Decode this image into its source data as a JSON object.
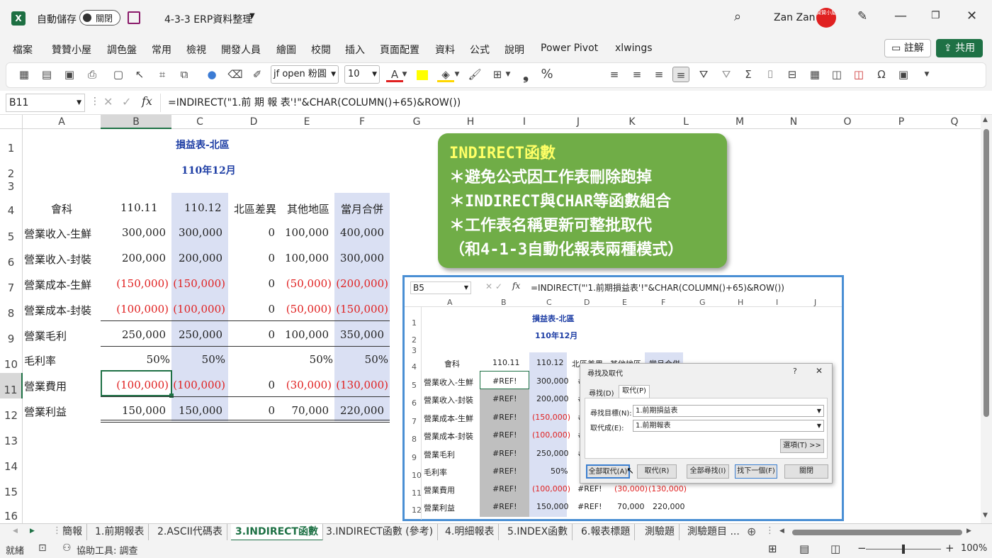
{
  "titlebar": {
    "autosave_label": "自動儲存",
    "autosave_state": "關閉",
    "file_name": "4-3-3 ERP資料整理",
    "user_name": "Zan Zan",
    "avatar_text": "贊贊小屋"
  },
  "menu": [
    "檔案",
    "贊贊小屋",
    "調色盤",
    "常用",
    "檢視",
    "開發人員",
    "繪圖",
    "校閱",
    "插入",
    "頁面配置",
    "資料",
    "公式",
    "說明",
    "Power Pivot",
    "xlwings"
  ],
  "buttons": {
    "comment": "註解",
    "share": "共用"
  },
  "toolbar": {
    "font_name": "jf open 粉圓 ",
    "font_size": "10",
    "percent": "%",
    "comma": "❟"
  },
  "formula_bar": {
    "name_box": "B11",
    "formula": "=INDIRECT(\"1.前 期 報 表'!\"&CHAR(COLUMN()+65)&ROW())",
    "fx": "fx"
  },
  "columns": [
    "A",
    "B",
    "C",
    "D",
    "E",
    "F",
    "G",
    "H",
    "I",
    "J",
    "K",
    "L",
    "M",
    "N",
    "O",
    "P",
    "Q"
  ],
  "rows": [
    "1",
    "2",
    "3",
    "4",
    "5",
    "6",
    "7",
    "8",
    "9",
    "10",
    "11",
    "12",
    "13",
    "14",
    "15",
    "16"
  ],
  "sheet": {
    "title": "損益表-北區",
    "subtitle": "110年12月",
    "headers": [
      "會科",
      "110.11",
      "110.12",
      "北區差異",
      "其他地區",
      "當月合併"
    ],
    "data": [
      [
        "營業收入-生鮮",
        "300,000",
        "300,000",
        "0",
        "100,000",
        "400,000"
      ],
      [
        "營業收入-封裝",
        "200,000",
        "200,000",
        "0",
        "100,000",
        "300,000"
      ],
      [
        "營業成本-生鮮",
        "(150,000)",
        "(150,000)",
        "0",
        "(50,000)",
        "(200,000)"
      ],
      [
        "營業成本-封裝",
        "(100,000)",
        "(100,000)",
        "0",
        "(50,000)",
        "(150,000)"
      ],
      [
        "營業毛利",
        "250,000",
        "250,000",
        "0",
        "100,000",
        "350,000"
      ],
      [
        "毛利率",
        "50%",
        "50%",
        "",
        "50%",
        "50%"
      ],
      [
        "營業費用",
        "(100,000)",
        "(100,000)",
        "0",
        "(30,000)",
        "(130,000)"
      ],
      [
        "營業利益",
        "150,000",
        "150,000",
        "0",
        "70,000",
        "220,000"
      ]
    ]
  },
  "callout": {
    "lines": [
      "INDIRECT函數",
      "＊避免公式因工作表刪除跑掉",
      "＊INDIRECT與CHAR等函數組合",
      "＊工作表名稱更新可整批取代",
      "（和4-1-3自動化報表兩種模式）"
    ]
  },
  "inset": {
    "name_box": "B5",
    "formula": "=INDIRECT(\"'1.前期損益表'!\"&CHAR(COLUMN()+65)&ROW())",
    "columns": [
      "A",
      "B",
      "C",
      "D",
      "E",
      "F",
      "G",
      "H",
      "I",
      "J"
    ],
    "rows": [
      "1",
      "2",
      "3",
      "4",
      "5",
      "6",
      "7",
      "8",
      "9",
      "10",
      "11",
      "12"
    ],
    "title": "損益表-北區",
    "subtitle": "110年12月",
    "headers": [
      "會科",
      "110.11",
      "110.12",
      "北區差異",
      "其他地區",
      "當月合併"
    ],
    "data": [
      [
        "營業收入-生鮮",
        "#REF!",
        "300,000",
        "#"
      ],
      [
        "營業收入-封裝",
        "#REF!",
        "200,000",
        "#"
      ],
      [
        "營業成本-生鮮",
        "#REF!",
        "(150,000)",
        "#"
      ],
      [
        "營業成本-封裝",
        "#REF!",
        "(100,000)",
        "#"
      ],
      [
        "營業毛利",
        "#REF!",
        "250,000",
        "#"
      ],
      [
        "毛利率",
        "#REF!",
        "50%",
        ""
      ],
      [
        "營業費用",
        "#REF!",
        "(100,000)",
        "#REF!",
        "(30,000)",
        "(130,000)"
      ],
      [
        "營業利益",
        "#REF!",
        "150,000",
        "#REF!",
        "70,000",
        "220,000"
      ]
    ]
  },
  "dialog": {
    "title": "尋找及取代",
    "help": "?",
    "close": "✕",
    "tab_find": "尋找(D)",
    "tab_replace": "取代(P)",
    "find_label": "尋找目標(N):",
    "find_value": "1.前期損益表",
    "replace_label": "取代成(E):",
    "replace_value": "1.前期報表",
    "options": "選項(T) >>",
    "btn_replace_all": "全部取代(A)",
    "btn_replace": "取代(R)",
    "btn_find_all": "全部尋找(I)",
    "btn_find_next": "找下一個(F)",
    "btn_close": "關閉"
  },
  "tabs": [
    "簡報",
    "1.前期報表",
    "2.ASCII代碼表",
    "3.INDIRECT函數",
    "3.INDIRECT函數 (參考)",
    "4.明細報表",
    "5.INDEX函數",
    "6.報表標題",
    "測驗題",
    "測驗題目 ..."
  ],
  "active_tab": "3.INDIRECT函數",
  "status": {
    "ready": "就緒",
    "accessibility": "協助工具: 調查",
    "zoom": "100%"
  }
}
